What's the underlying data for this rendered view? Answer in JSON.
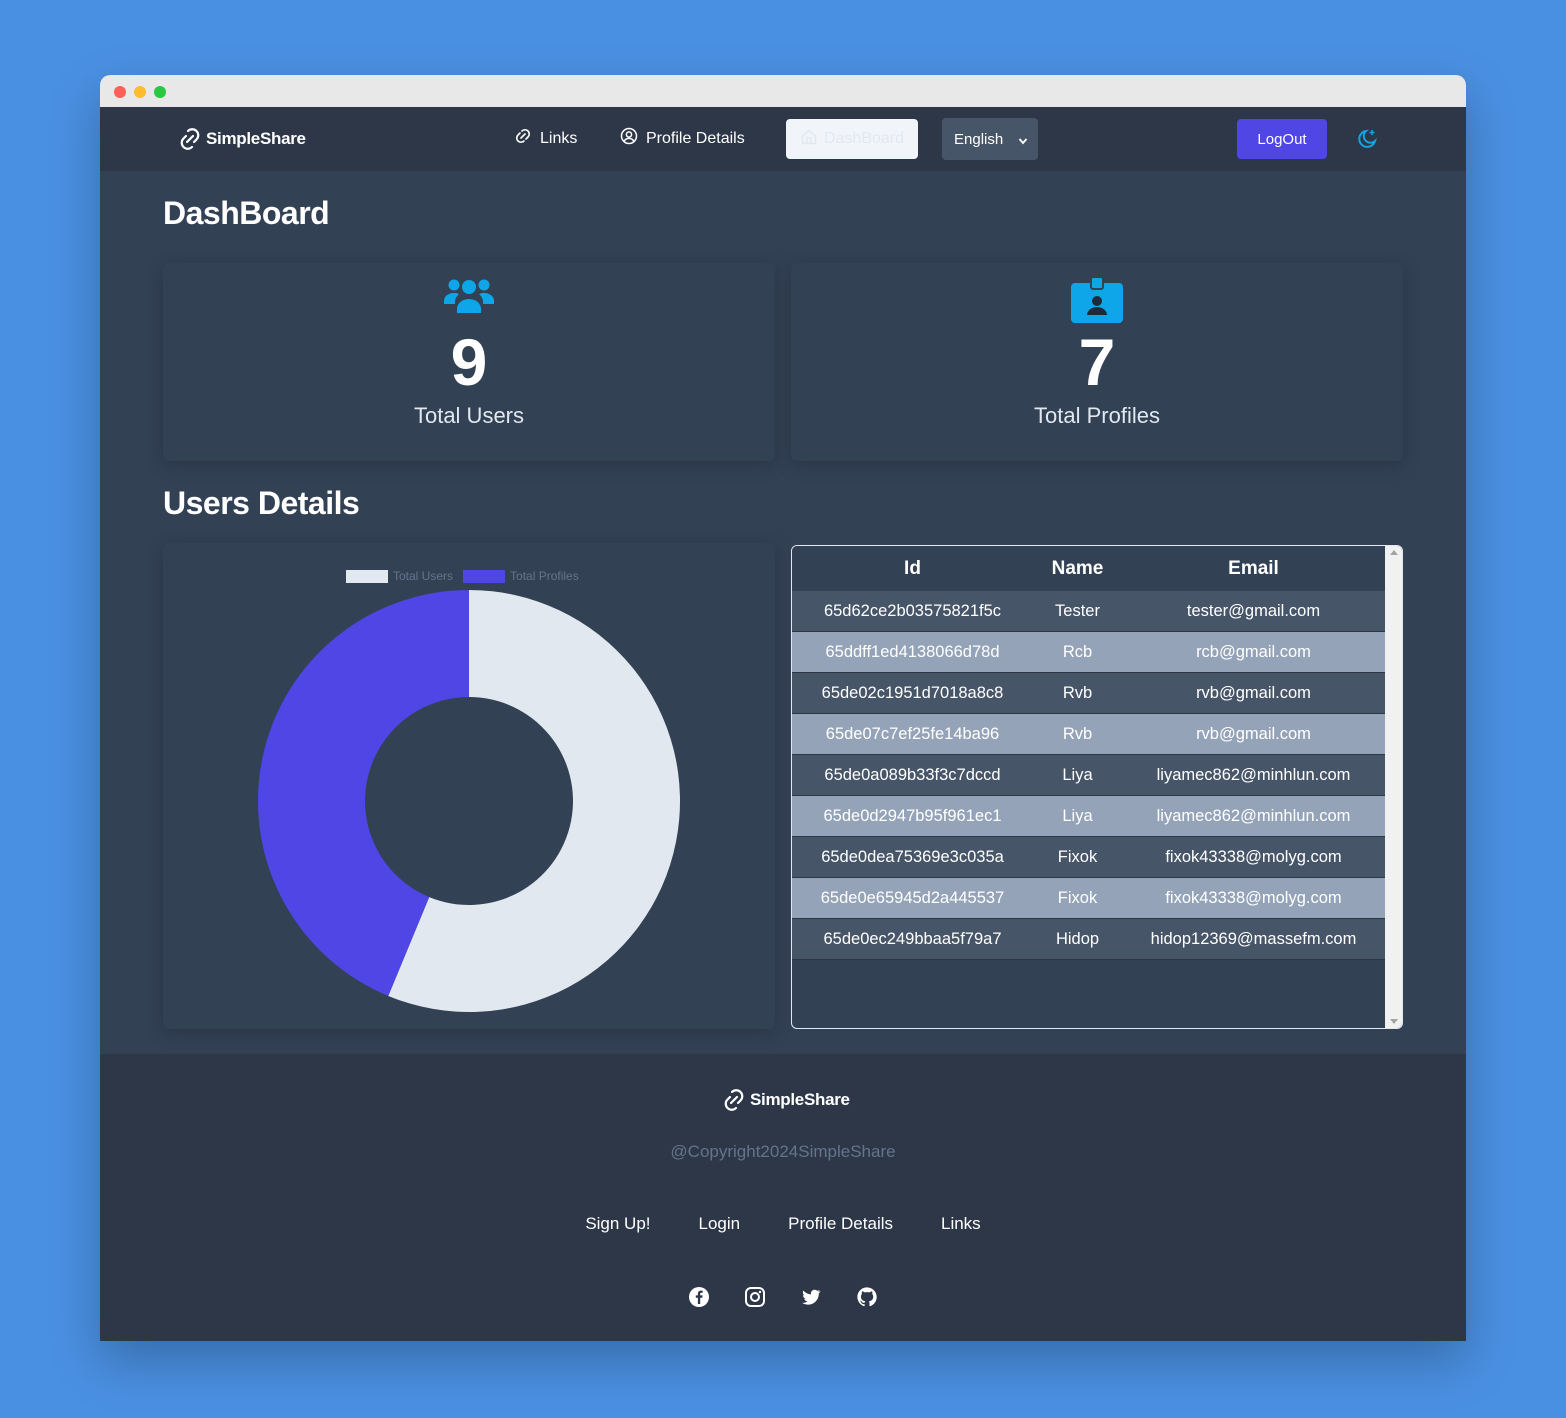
{
  "nav": {
    "brand": "SimpleShare",
    "links_label": "Links",
    "profile_label": "Profile Details",
    "dashboard_label": "DashBoard",
    "language": "English",
    "logout_label": "LogOut"
  },
  "page": {
    "title": "DashBoard",
    "users_section": "Users Details"
  },
  "stats": {
    "users_value": "9",
    "users_label": "Total Users",
    "profiles_value": "7",
    "profiles_label": "Total Profiles"
  },
  "chart_data": {
    "type": "pie",
    "categories": [
      "Total Users",
      "Total Profiles"
    ],
    "values": [
      9,
      7
    ],
    "colors": [
      "#e2e8f0",
      "#4f46e5"
    ],
    "legend_position": "top"
  },
  "table": {
    "headers": [
      "Id",
      "Name",
      "Email"
    ],
    "rows": [
      [
        "65d62ce2b03575821f5c",
        "Tester",
        "tester@gmail.com"
      ],
      [
        "65ddff1ed4138066d78d",
        "Rcb",
        "rcb@gmail.com"
      ],
      [
        "65de02c1951d7018a8c8",
        "Rvb",
        "rvb@gmail.com"
      ],
      [
        "65de07c7ef25fe14ba96",
        "Rvb",
        "rvb@gmail.com"
      ],
      [
        "65de0a089b33f3c7dccd",
        "Liya",
        "liyamec862@minhlun.com"
      ],
      [
        "65de0d2947b95f961ec1",
        "Liya",
        "liyamec862@minhlun.com"
      ],
      [
        "65de0dea75369e3c035a",
        "Fixok",
        "fixok43338@molyg.com"
      ],
      [
        "65de0e65945d2a445537",
        "Fixok",
        "fixok43338@molyg.com"
      ],
      [
        "65de0ec249bbaa5f79a7",
        "Hidop",
        "hidop12369@massefm.com"
      ]
    ]
  },
  "footer": {
    "brand": "SimpleShare",
    "copyright": "@Copyright2024SimpleShare",
    "links": [
      "Sign Up!",
      "Login",
      "Profile Details",
      "Links"
    ],
    "socials": [
      "facebook-icon",
      "instagram-icon",
      "twitter-icon",
      "github-icon"
    ]
  },
  "colors": {
    "accent": "#4f46e5",
    "icon_blue": "#0ea5e9",
    "navbar": "#2d3748",
    "panel": "#334155"
  }
}
